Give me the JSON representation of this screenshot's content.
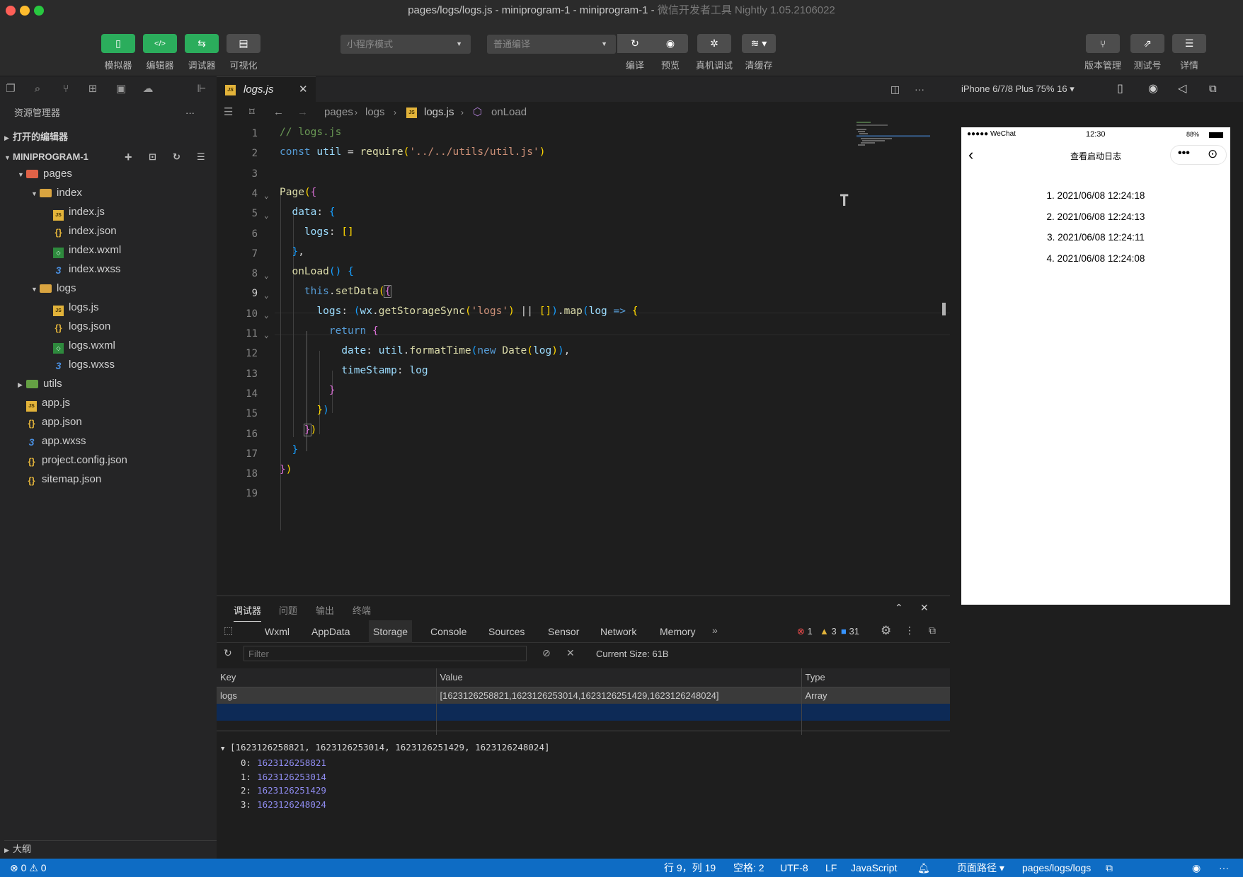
{
  "window": {
    "title_main": "pages/logs/logs.js - miniprogram-1 - miniprogram-1 - ",
    "title_faint": "微信开发者工具 Nightly 1.05.2106022"
  },
  "toolbar": {
    "simulator": "模拟器",
    "editor": "编辑器",
    "debugger": "调试器",
    "visual": "可视化",
    "mode_select": "小程序模式",
    "compile_select": "普通编译",
    "compile": "编译",
    "preview": "预览",
    "remote_debug": "真机调试",
    "clear_cache": "清缓存",
    "version": "版本管理",
    "test_account": "测试号",
    "details": "详情"
  },
  "explorer": {
    "title": "资源管理器",
    "more": "···",
    "open_editors": "打开的编辑器",
    "project": "MINIPROGRAM-1",
    "outline": "大纲",
    "tree": [
      {
        "name": "pages",
        "type": "folder-red",
        "depth": 1,
        "open": true
      },
      {
        "name": "index",
        "type": "folder",
        "depth": 2,
        "open": true
      },
      {
        "name": "index.js",
        "type": "js",
        "depth": 3
      },
      {
        "name": "index.json",
        "type": "json",
        "depth": 3
      },
      {
        "name": "index.wxml",
        "type": "wxml",
        "depth": 3
      },
      {
        "name": "index.wxss",
        "type": "wxss",
        "depth": 3
      },
      {
        "name": "logs",
        "type": "folder",
        "depth": 2,
        "open": true
      },
      {
        "name": "logs.js",
        "type": "js",
        "depth": 3
      },
      {
        "name": "logs.json",
        "type": "json",
        "depth": 3
      },
      {
        "name": "logs.wxml",
        "type": "wxml",
        "depth": 3
      },
      {
        "name": "logs.wxss",
        "type": "wxss",
        "depth": 3
      },
      {
        "name": "utils",
        "type": "folder-green",
        "depth": 1,
        "open": false
      },
      {
        "name": "app.js",
        "type": "js",
        "depth": 1
      },
      {
        "name": "app.json",
        "type": "json",
        "depth": 1
      },
      {
        "name": "app.wxss",
        "type": "wxss",
        "depth": 1
      },
      {
        "name": "project.config.json",
        "type": "json",
        "depth": 1
      },
      {
        "name": "sitemap.json",
        "type": "json",
        "depth": 1
      }
    ]
  },
  "editor": {
    "tab": "logs.js",
    "breadcrumb": [
      "pages",
      "logs",
      "logs.js",
      "onLoad"
    ],
    "line_numbers": [
      "1",
      "2",
      "3",
      "4",
      "5",
      "6",
      "7",
      "8",
      "9",
      "10",
      "11",
      "12",
      "13",
      "14",
      "15",
      "16",
      "17",
      "18",
      "19"
    ]
  },
  "simulator": {
    "device": "iPhone 6/7/8 Plus 75% 16 ▾",
    "carrier": "●●●●● WeChat",
    "time": "12:30",
    "battery": "88%",
    "page_title": "查看启动日志",
    "logs": [
      "1. 2021/06/08 12:24:18",
      "2. 2021/06/08 12:24:13",
      "3. 2021/06/08 12:24:11",
      "4. 2021/06/08 12:24:08"
    ]
  },
  "panel": {
    "tabs": [
      "调试器",
      "问题",
      "输出",
      "终端"
    ],
    "devtools_tabs": [
      "Wxml",
      "AppData",
      "Storage",
      "Console",
      "Sources",
      "Sensor",
      "Network",
      "Memory"
    ],
    "errors": "1",
    "warnings": "3",
    "infos": "31",
    "filter_placeholder": "Filter",
    "current_size": "Current Size: 61B",
    "columns": [
      "Key",
      "Value",
      "Type"
    ],
    "row": {
      "key": "logs",
      "value": "[1623126258821,1623126253014,1623126251429,1623126248024]",
      "type": "Array"
    },
    "preview_header": "[1623126258821, 1623126253014, 1623126251429, 1623126248024]",
    "preview_items": [
      {
        "k": "0:",
        "v": "1623126258821"
      },
      {
        "k": "1:",
        "v": "1623126253014"
      },
      {
        "k": "2:",
        "v": "1623126251429"
      },
      {
        "k": "3:",
        "v": "1623126248024"
      }
    ]
  },
  "status": {
    "problems": "⊗ 0 ⚠ 0",
    "position": "行 9，列 19",
    "spaces": "空格: 2",
    "encoding": "UTF-8",
    "eol": "LF",
    "language": "JavaScript",
    "page_path_label": "页面路径 ▾",
    "page_path": "pages/logs/logs"
  }
}
